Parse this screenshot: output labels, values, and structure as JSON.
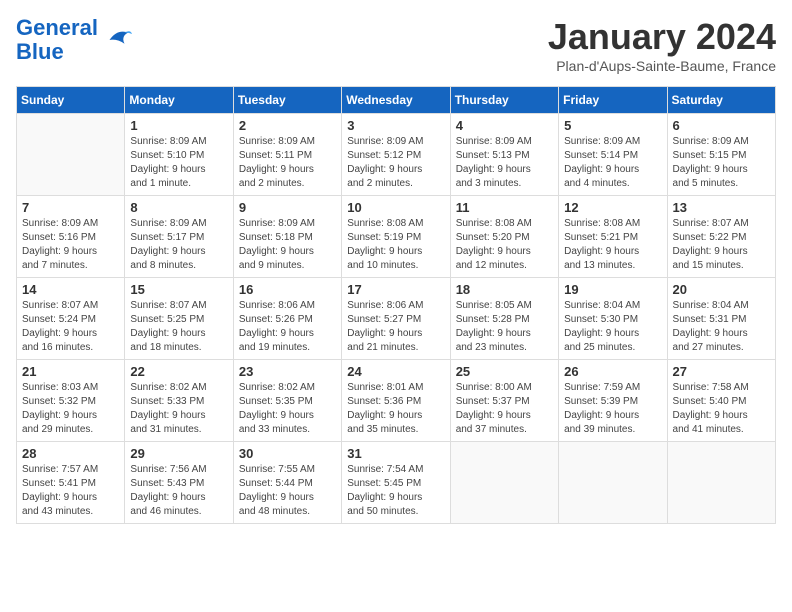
{
  "header": {
    "logo": {
      "line1": "General",
      "line2": "Blue"
    },
    "month": "January 2024",
    "location": "Plan-d'Aups-Sainte-Baume, France"
  },
  "weekdays": [
    "Sunday",
    "Monday",
    "Tuesday",
    "Wednesday",
    "Thursday",
    "Friday",
    "Saturday"
  ],
  "weeks": [
    [
      {
        "day": "",
        "info": ""
      },
      {
        "day": "1",
        "info": "Sunrise: 8:09 AM\nSunset: 5:10 PM\nDaylight: 9 hours\nand 1 minute."
      },
      {
        "day": "2",
        "info": "Sunrise: 8:09 AM\nSunset: 5:11 PM\nDaylight: 9 hours\nand 2 minutes."
      },
      {
        "day": "3",
        "info": "Sunrise: 8:09 AM\nSunset: 5:12 PM\nDaylight: 9 hours\nand 2 minutes."
      },
      {
        "day": "4",
        "info": "Sunrise: 8:09 AM\nSunset: 5:13 PM\nDaylight: 9 hours\nand 3 minutes."
      },
      {
        "day": "5",
        "info": "Sunrise: 8:09 AM\nSunset: 5:14 PM\nDaylight: 9 hours\nand 4 minutes."
      },
      {
        "day": "6",
        "info": "Sunrise: 8:09 AM\nSunset: 5:15 PM\nDaylight: 9 hours\nand 5 minutes."
      }
    ],
    [
      {
        "day": "7",
        "info": "Sunrise: 8:09 AM\nSunset: 5:16 PM\nDaylight: 9 hours\nand 7 minutes."
      },
      {
        "day": "8",
        "info": "Sunrise: 8:09 AM\nSunset: 5:17 PM\nDaylight: 9 hours\nand 8 minutes."
      },
      {
        "day": "9",
        "info": "Sunrise: 8:09 AM\nSunset: 5:18 PM\nDaylight: 9 hours\nand 9 minutes."
      },
      {
        "day": "10",
        "info": "Sunrise: 8:08 AM\nSunset: 5:19 PM\nDaylight: 9 hours\nand 10 minutes."
      },
      {
        "day": "11",
        "info": "Sunrise: 8:08 AM\nSunset: 5:20 PM\nDaylight: 9 hours\nand 12 minutes."
      },
      {
        "day": "12",
        "info": "Sunrise: 8:08 AM\nSunset: 5:21 PM\nDaylight: 9 hours\nand 13 minutes."
      },
      {
        "day": "13",
        "info": "Sunrise: 8:07 AM\nSunset: 5:22 PM\nDaylight: 9 hours\nand 15 minutes."
      }
    ],
    [
      {
        "day": "14",
        "info": "Sunrise: 8:07 AM\nSunset: 5:24 PM\nDaylight: 9 hours\nand 16 minutes."
      },
      {
        "day": "15",
        "info": "Sunrise: 8:07 AM\nSunset: 5:25 PM\nDaylight: 9 hours\nand 18 minutes."
      },
      {
        "day": "16",
        "info": "Sunrise: 8:06 AM\nSunset: 5:26 PM\nDaylight: 9 hours\nand 19 minutes."
      },
      {
        "day": "17",
        "info": "Sunrise: 8:06 AM\nSunset: 5:27 PM\nDaylight: 9 hours\nand 21 minutes."
      },
      {
        "day": "18",
        "info": "Sunrise: 8:05 AM\nSunset: 5:28 PM\nDaylight: 9 hours\nand 23 minutes."
      },
      {
        "day": "19",
        "info": "Sunrise: 8:04 AM\nSunset: 5:30 PM\nDaylight: 9 hours\nand 25 minutes."
      },
      {
        "day": "20",
        "info": "Sunrise: 8:04 AM\nSunset: 5:31 PM\nDaylight: 9 hours\nand 27 minutes."
      }
    ],
    [
      {
        "day": "21",
        "info": "Sunrise: 8:03 AM\nSunset: 5:32 PM\nDaylight: 9 hours\nand 29 minutes."
      },
      {
        "day": "22",
        "info": "Sunrise: 8:02 AM\nSunset: 5:33 PM\nDaylight: 9 hours\nand 31 minutes."
      },
      {
        "day": "23",
        "info": "Sunrise: 8:02 AM\nSunset: 5:35 PM\nDaylight: 9 hours\nand 33 minutes."
      },
      {
        "day": "24",
        "info": "Sunrise: 8:01 AM\nSunset: 5:36 PM\nDaylight: 9 hours\nand 35 minutes."
      },
      {
        "day": "25",
        "info": "Sunrise: 8:00 AM\nSunset: 5:37 PM\nDaylight: 9 hours\nand 37 minutes."
      },
      {
        "day": "26",
        "info": "Sunrise: 7:59 AM\nSunset: 5:39 PM\nDaylight: 9 hours\nand 39 minutes."
      },
      {
        "day": "27",
        "info": "Sunrise: 7:58 AM\nSunset: 5:40 PM\nDaylight: 9 hours\nand 41 minutes."
      }
    ],
    [
      {
        "day": "28",
        "info": "Sunrise: 7:57 AM\nSunset: 5:41 PM\nDaylight: 9 hours\nand 43 minutes."
      },
      {
        "day": "29",
        "info": "Sunrise: 7:56 AM\nSunset: 5:43 PM\nDaylight: 9 hours\nand 46 minutes."
      },
      {
        "day": "30",
        "info": "Sunrise: 7:55 AM\nSunset: 5:44 PM\nDaylight: 9 hours\nand 48 minutes."
      },
      {
        "day": "31",
        "info": "Sunrise: 7:54 AM\nSunset: 5:45 PM\nDaylight: 9 hours\nand 50 minutes."
      },
      {
        "day": "",
        "info": ""
      },
      {
        "day": "",
        "info": ""
      },
      {
        "day": "",
        "info": ""
      }
    ]
  ]
}
